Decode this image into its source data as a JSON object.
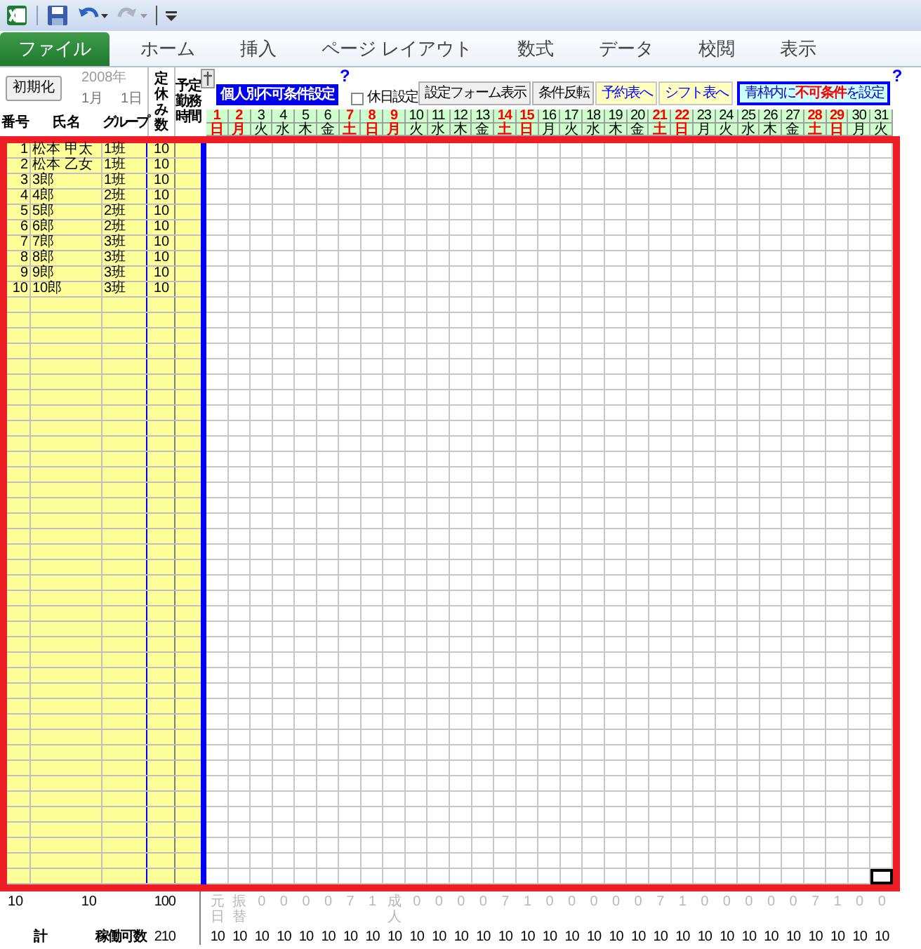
{
  "ribbon_tabs": [
    {
      "label": "ファイル",
      "selected": true
    },
    {
      "label": "ホーム",
      "selected": false
    },
    {
      "label": "挿入",
      "selected": false
    },
    {
      "label": "ページ レイアウト",
      "selected": false
    },
    {
      "label": "数式",
      "selected": false
    },
    {
      "label": "データ",
      "selected": false
    },
    {
      "label": "校閲",
      "selected": false
    },
    {
      "label": "表示",
      "selected": false
    }
  ],
  "sheet_header": {
    "reset_button": "初期化",
    "year": "2008年",
    "month": "1月",
    "day": "1日"
  },
  "columns": {
    "number": "番号",
    "name": "氏名",
    "group": "グループ",
    "days_off": "定休み数",
    "work_hours": "予定勤務時間"
  },
  "controls": [
    {
      "kind": "primary",
      "label": "個人別不可条件設定"
    },
    {
      "kind": "help",
      "label": "?"
    },
    {
      "kind": "checkbox",
      "label": "休日設定",
      "checked": false
    },
    {
      "kind": "button",
      "label": "設定フォーム表示"
    },
    {
      "kind": "button",
      "label": "条件反転"
    },
    {
      "kind": "link",
      "label": "予約表へ"
    },
    {
      "kind": "link",
      "label": "シフト表へ"
    },
    {
      "kind": "notice",
      "label": "青枠内に**不可条件**を設定"
    },
    {
      "kind": "help",
      "label": "?"
    }
  ],
  "days": [
    {
      "number": "1",
      "weekday": "日",
      "holiday": true,
      "note": "元日",
      "available": "10"
    },
    {
      "number": "2",
      "weekday": "月",
      "holiday": true,
      "note": "振替",
      "available": "10"
    },
    {
      "number": "3",
      "weekday": "火",
      "holiday": false,
      "note": "0",
      "available": "10"
    },
    {
      "number": "4",
      "weekday": "水",
      "holiday": false,
      "note": "0",
      "available": "10"
    },
    {
      "number": "5",
      "weekday": "木",
      "holiday": false,
      "note": "0",
      "available": "10"
    },
    {
      "number": "6",
      "weekday": "金",
      "holiday": false,
      "note": "0",
      "available": "10"
    },
    {
      "number": "7",
      "weekday": "土",
      "holiday": true,
      "note": "7",
      "available": "10"
    },
    {
      "number": "8",
      "weekday": "日",
      "holiday": true,
      "note": "1",
      "available": "10"
    },
    {
      "number": "9",
      "weekday": "月",
      "holiday": true,
      "note": "成人",
      "available": "10"
    },
    {
      "number": "10",
      "weekday": "火",
      "holiday": false,
      "note": "0",
      "available": "10"
    },
    {
      "number": "11",
      "weekday": "水",
      "holiday": false,
      "note": "0",
      "available": "10"
    },
    {
      "number": "12",
      "weekday": "木",
      "holiday": false,
      "note": "0",
      "available": "10"
    },
    {
      "number": "13",
      "weekday": "金",
      "holiday": false,
      "note": "0",
      "available": "10"
    },
    {
      "number": "14",
      "weekday": "土",
      "holiday": true,
      "note": "7",
      "available": "10"
    },
    {
      "number": "15",
      "weekday": "日",
      "holiday": true,
      "note": "1",
      "available": "10"
    },
    {
      "number": "16",
      "weekday": "月",
      "holiday": false,
      "note": "0",
      "available": "10"
    },
    {
      "number": "17",
      "weekday": "火",
      "holiday": false,
      "note": "0",
      "available": "10"
    },
    {
      "number": "18",
      "weekday": "水",
      "holiday": false,
      "note": "0",
      "available": "10"
    },
    {
      "number": "19",
      "weekday": "木",
      "holiday": false,
      "note": "0",
      "available": "10"
    },
    {
      "number": "20",
      "weekday": "金",
      "holiday": false,
      "note": "0",
      "available": "10"
    },
    {
      "number": "21",
      "weekday": "土",
      "holiday": true,
      "note": "7",
      "available": "10"
    },
    {
      "number": "22",
      "weekday": "日",
      "holiday": true,
      "note": "1",
      "available": "10"
    },
    {
      "number": "23",
      "weekday": "月",
      "holiday": false,
      "note": "0",
      "available": "10"
    },
    {
      "number": "24",
      "weekday": "火",
      "holiday": false,
      "note": "0",
      "available": "10"
    },
    {
      "number": "25",
      "weekday": "水",
      "holiday": false,
      "note": "0",
      "available": "10"
    },
    {
      "number": "26",
      "weekday": "木",
      "holiday": false,
      "note": "0",
      "available": "10"
    },
    {
      "number": "27",
      "weekday": "金",
      "holiday": false,
      "note": "0",
      "available": "10"
    },
    {
      "number": "28",
      "weekday": "土",
      "holiday": true,
      "note": "7",
      "available": "10"
    },
    {
      "number": "29",
      "weekday": "日",
      "holiday": true,
      "note": "1",
      "available": "10"
    },
    {
      "number": "30",
      "weekday": "月",
      "holiday": false,
      "note": "0",
      "available": "10"
    },
    {
      "number": "31",
      "weekday": "火",
      "holiday": false,
      "note": "0",
      "available": "10"
    }
  ],
  "rows": [
    {
      "number": "1",
      "name": "松本 甲太",
      "group": "1班",
      "days_off": "10"
    },
    {
      "number": "2",
      "name": "松本 乙女",
      "group": "1班",
      "days_off": "10"
    },
    {
      "number": "3",
      "name": "3郎",
      "group": "1班",
      "days_off": "10"
    },
    {
      "number": "4",
      "name": "4郎",
      "group": "2班",
      "days_off": "10"
    },
    {
      "number": "5",
      "name": "5郎",
      "group": "2班",
      "days_off": "10"
    },
    {
      "number": "6",
      "name": "6郎",
      "group": "2班",
      "days_off": "10"
    },
    {
      "number": "7",
      "name": "7郎",
      "group": "3班",
      "days_off": "10"
    },
    {
      "number": "8",
      "name": "8郎",
      "group": "3班",
      "days_off": "10"
    },
    {
      "number": "9",
      "name": "9郎",
      "group": "3班",
      "days_off": "10"
    },
    {
      "number": "10",
      "name": "10郎",
      "group": "3班",
      "days_off": "10"
    }
  ],
  "footer": {
    "count": "10",
    "members": "10",
    "days_off_total": "100",
    "total_label": "計",
    "available_label": "稼働可数",
    "available_total": "210"
  }
}
